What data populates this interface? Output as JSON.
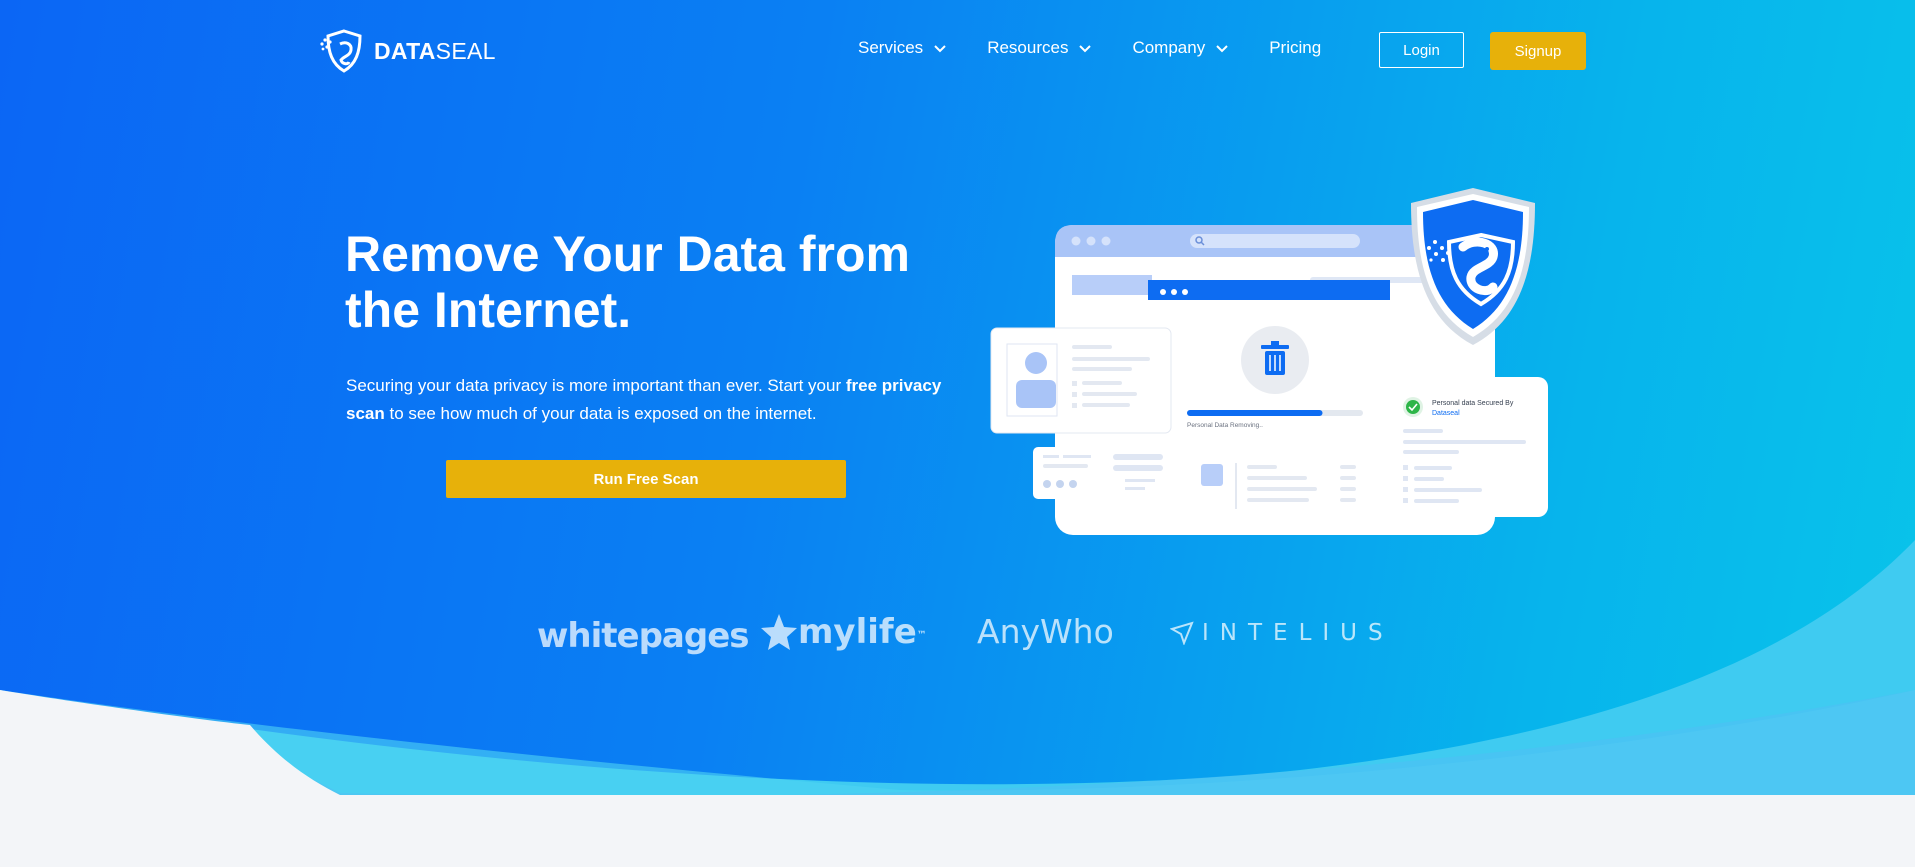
{
  "brand": {
    "name_bold": "DATA",
    "name_light": "SEAL",
    "logo_icon": "seal-shield-icon"
  },
  "nav": {
    "items": [
      {
        "label": "Services",
        "has_dropdown": true
      },
      {
        "label": "Resources",
        "has_dropdown": true
      },
      {
        "label": "Company",
        "has_dropdown": true
      },
      {
        "label": "Pricing",
        "has_dropdown": false
      }
    ],
    "login_label": "Login",
    "signup_label": "Signup"
  },
  "hero": {
    "headline": "Remove Your Data from the Internet.",
    "subtext_before": "Securing your data privacy is more important than ever. Start your ",
    "subtext_bold": "free privacy scan",
    "subtext_after": " to see how much of your data is exposed on the internet.",
    "cta_label": "Run Free Scan"
  },
  "illustration": {
    "progress_caption": "Personal Data Removing..",
    "progress_value": 0.77,
    "secured_title": "Personal data Secured By",
    "secured_brand": "Dataseal",
    "icons": [
      "trash-icon",
      "search-icon",
      "check-circle-icon",
      "user-avatar-icon",
      "seal-shield-icon"
    ]
  },
  "partners": [
    "whitepages",
    "mylife",
    "AnyWho",
    "INTELIUS"
  ],
  "partners_tm": "™",
  "colors": {
    "gradient_start": "#0b66f5",
    "gradient_end": "#09c4ea",
    "accent": "#e7b10a",
    "light_bg": "#f3f5f8"
  }
}
